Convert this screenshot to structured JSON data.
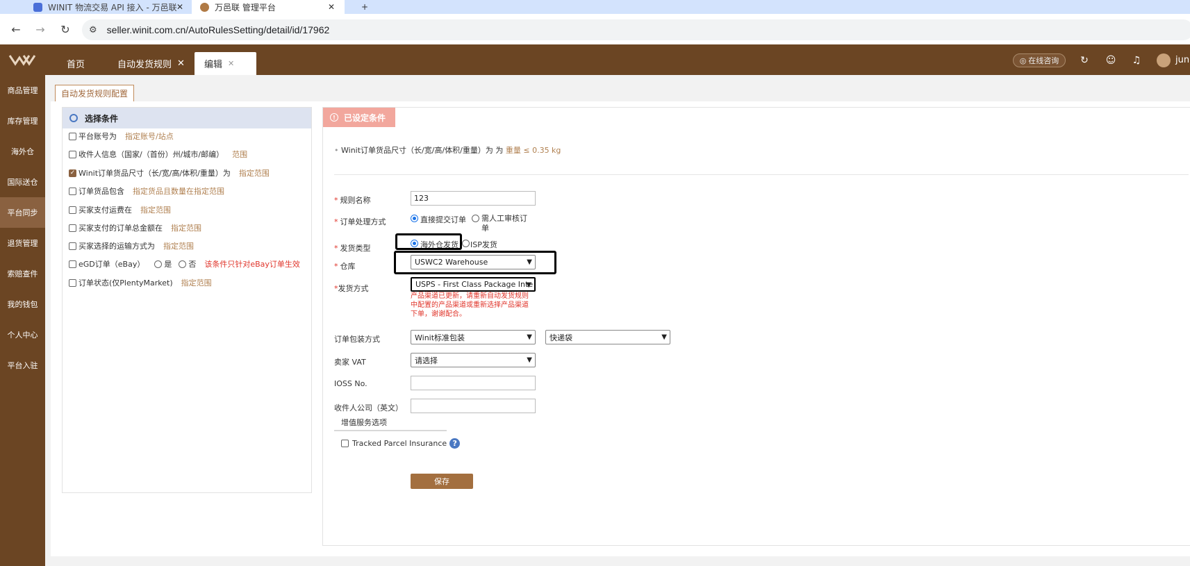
{
  "browser": {
    "tabs": [
      {
        "label": "WINIT 物流交易 API 接入 - 万邑联"
      },
      {
        "label": "万邑联 管理平台"
      }
    ],
    "url": "seller.winit.com.cn/AutoRulesSetting/detail/id/17962"
  },
  "header": {
    "tabs": [
      {
        "label": "首页"
      },
      {
        "label": "自动发货规则"
      },
      {
        "label": "编辑"
      }
    ],
    "consult_label": "在线咨询",
    "username": "jun"
  },
  "sidebar": {
    "items": [
      {
        "label": "商品管理"
      },
      {
        "label": "库存管理"
      },
      {
        "label": "海外仓"
      },
      {
        "label": "国际送仓"
      },
      {
        "label": "平台同步"
      },
      {
        "label": "退货管理"
      },
      {
        "label": "索赔查件"
      },
      {
        "label": "我的钱包"
      },
      {
        "label": "个人中心"
      },
      {
        "label": "平台入驻"
      }
    ]
  },
  "page": {
    "tab_label": "自动发货规则配置"
  },
  "conditions": {
    "title": "选择条件",
    "items": [
      {
        "label": "平台账号为",
        "range": "指定账号/站点",
        "checked": false
      },
      {
        "label": "收件人信息（国家/（首份）州/城市/邮编）",
        "range": "范围",
        "checked": false
      },
      {
        "label": "Winit订单货品尺寸（长/宽/高/体积/重量）为",
        "range": "指定范围",
        "checked": true
      },
      {
        "label": "订单货品包含",
        "range": "指定货品且数量在指定范围",
        "checked": false
      },
      {
        "label": "买家支付运费在",
        "range": "指定范围",
        "checked": false
      },
      {
        "label": "买家支付的订单总金额在",
        "range": "指定范围",
        "checked": false
      },
      {
        "label": "买家选择的运输方式为",
        "range": "指定范围",
        "checked": false
      },
      {
        "label": "eGD订单（eBay）",
        "opt_yes": "是",
        "opt_no": "否",
        "note": "该条件只针对eBay订单生效",
        "checked": false
      },
      {
        "label": "订单状态(仅PlentyMarket)",
        "range": "指定范围",
        "checked": false
      }
    ]
  },
  "settings": {
    "title": "已设定条件",
    "set_condition_text": "Winit订单货品尺寸（长/宽/高/体积/重量）为",
    "set_condition_value": "重量 ≤ 0.35 kg",
    "rule_name_label": "规则名称",
    "rule_name_value": "123",
    "process_label": "订单处理方式",
    "process_opt1": "直接提交订单",
    "process_opt2": "需人工审核订单",
    "ship_type_label": "发货类型",
    "ship_type_opt1": "海外仓发货",
    "ship_type_opt2": "ISP发货",
    "warehouse_label": "仓库",
    "warehouse_value": "USWC2 Warehouse",
    "ship_method_label": "发货方式",
    "ship_method_value": "USPS - First Class Package Inte",
    "warning": "产品渠道已更新，请重新自动发货规则中配置的产品渠道或重新选择产品渠道下单，谢谢配合。",
    "packaging_label": "订单包装方式",
    "packaging_value1": "Winit标准包装",
    "packaging_value2": "快递袋",
    "vat_label": "卖家 VAT",
    "vat_value": "请选择",
    "ioss_label": "IOSS No.",
    "company_label": "收件人公司（英文）",
    "vas_tab": "增值服务选项",
    "insurance_label": "Tracked Parcel Insurance",
    "save_label": "保存"
  }
}
